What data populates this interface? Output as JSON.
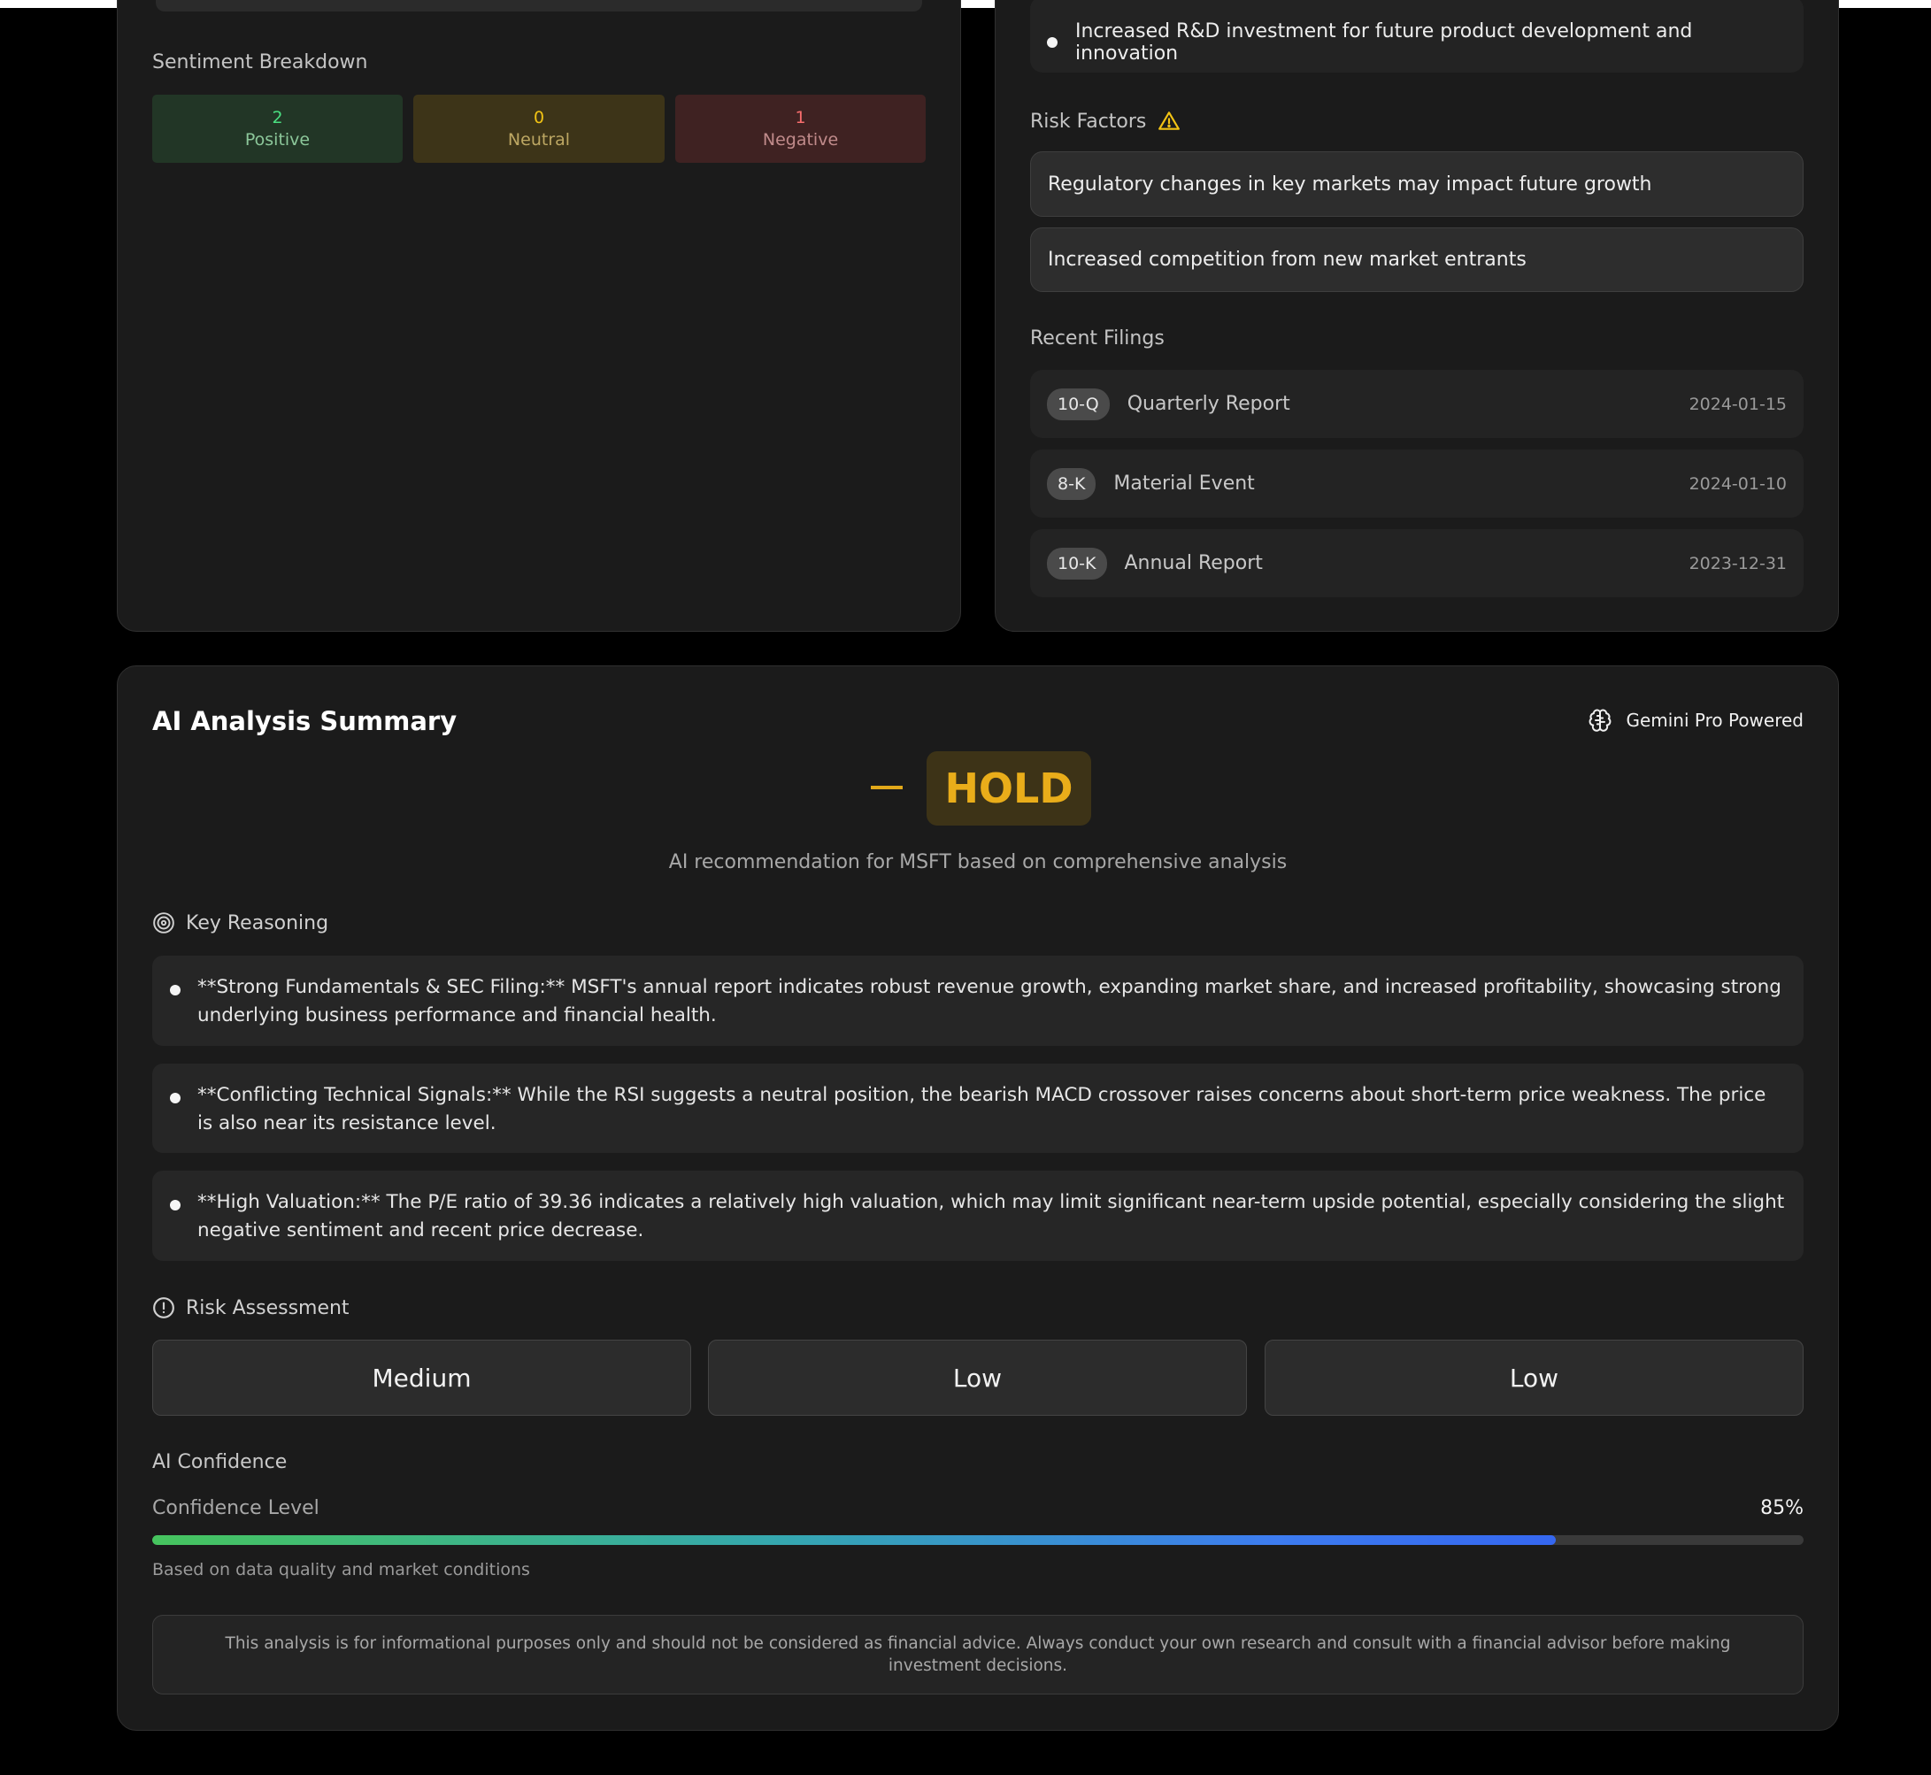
{
  "sentiment": {
    "title": "Sentiment Breakdown",
    "positive": {
      "count": "2",
      "label": "Positive"
    },
    "neutral": {
      "count": "0",
      "label": "Neutral"
    },
    "negative": {
      "count": "1",
      "label": "Negative"
    }
  },
  "highlights": {
    "last_item": "Increased R&D investment for future product development and innovation"
  },
  "risk_factors": {
    "title": "Risk Factors",
    "icon": "warning-icon",
    "items": [
      "Regulatory changes in key markets may impact future growth",
      "Increased competition from new market entrants"
    ]
  },
  "recent_filings": {
    "title": "Recent Filings",
    "items": [
      {
        "type": "10-Q",
        "name": "Quarterly Report",
        "date": "2024-01-15"
      },
      {
        "type": "8-K",
        "name": "Material Event",
        "date": "2024-01-10"
      },
      {
        "type": "10-K",
        "name": "Annual Report",
        "date": "2023-12-31"
      }
    ]
  },
  "ai_summary": {
    "title": "AI Analysis Summary",
    "powered_by": "Gemini Pro Powered",
    "powered_icon": "brain-icon",
    "recommendation": "HOLD",
    "recommendation_symbol": "—",
    "recommendation_subtitle": "AI recommendation for MSFT based on comprehensive analysis",
    "key_reasoning": {
      "title": "Key Reasoning",
      "icon": "target-icon",
      "items": [
        "**Strong Fundamentals & SEC Filing:** MSFT's annual report indicates robust revenue growth, expanding market share, and increased profitability, showcasing strong underlying business performance and financial health.",
        "**Conflicting Technical Signals:** While the RSI suggests a neutral position, the bearish MACD crossover raises concerns about short-term price weakness. The price is also near its resistance level.",
        "**High Valuation:** The P/E ratio of 39.36 indicates a relatively high valuation, which may limit significant near-term upside potential, especially considering the slight negative sentiment and recent price decrease."
      ]
    },
    "risk_assessment": {
      "title": "Risk Assessment",
      "icon": "alert-circle-icon",
      "values": [
        "Medium",
        "Low",
        "Low"
      ]
    },
    "confidence": {
      "title": "AI Confidence",
      "label": "Confidence Level",
      "value_text": "85%",
      "value": 0.85,
      "note": "Based on data quality and market conditions"
    },
    "disclaimer": "This analysis is for informational purposes only and should not be considered as financial advice. Always conduct your own research and consult with a financial advisor before making investment decisions."
  },
  "colors": {
    "positive": "#4ade80",
    "neutral": "#f2c314",
    "negative": "#f76d6d",
    "hold": "#e9ad1a",
    "warning": "#f2c314"
  }
}
